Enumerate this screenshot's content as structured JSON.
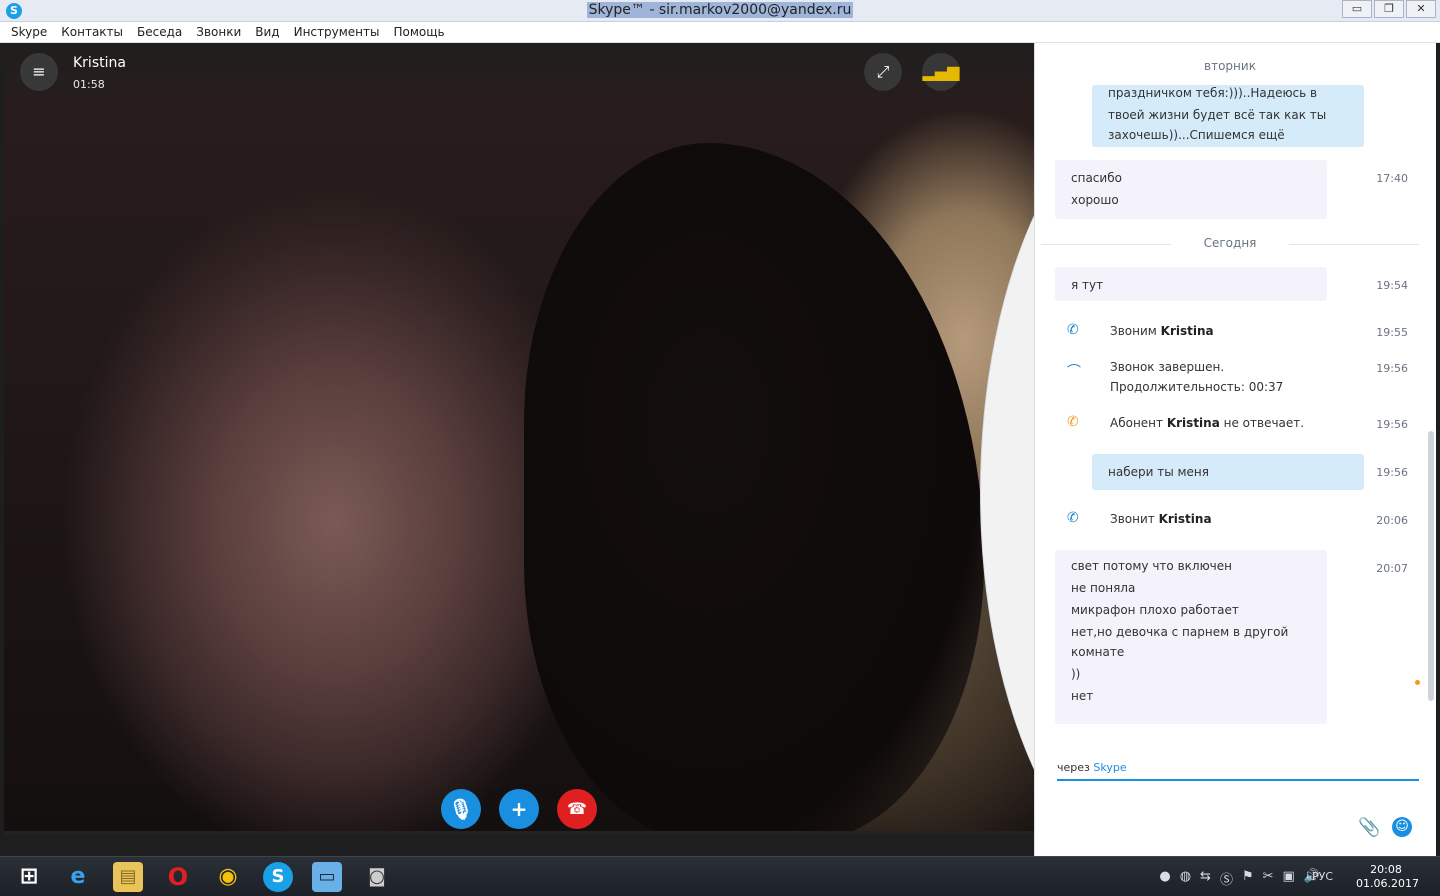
{
  "window": {
    "title": "Skype™ - sir.markov2000@yandex.ru",
    "controls": {
      "minimize": "▭",
      "restore": "❐",
      "close": "✕"
    }
  },
  "menu": [
    "Skype",
    "Контакты",
    "Беседа",
    "Звонки",
    "Вид",
    "Инструменты",
    "Помощь"
  ],
  "call": {
    "contact": "Kristina",
    "duration": "01:58",
    "icons": {
      "menu": "≡",
      "fullscreen": "⤢",
      "signal": "▂▄▆",
      "chat": "💬",
      "mic": "🎙",
      "add": "+",
      "hangup": "☎"
    }
  },
  "chat": {
    "day_tuesday": "вторник",
    "prev_out_message": [
      "праздничком тебя:)))..Надеюсь в",
      "твоей жизни будет всё так как ты",
      "захочешь))...Спишемся ещё"
    ],
    "msg1": {
      "lines": [
        "спасибо",
        "хорошо"
      ],
      "time": "17:40"
    },
    "day_today": "Сегодня",
    "msg2": {
      "lines": [
        "я тут"
      ],
      "time": "19:54"
    },
    "ev_calling": {
      "prefix": "Звоним",
      "name": "Kristina",
      "time": "19:55"
    },
    "ev_ended": {
      "line1": "Звонок завершен.",
      "line2": "Продолжительность: 00:37",
      "time": "19:56"
    },
    "ev_noanswer": {
      "prefix": "Абонент",
      "name": "Kristina",
      "suffix": "не отвечает.",
      "time": "19:56"
    },
    "msg_out": {
      "text": "набери ты меня",
      "time": "19:56"
    },
    "ev_incoming": {
      "prefix": "Звонит",
      "name": "Kristina",
      "time": "20:06"
    },
    "msg3": {
      "lines": [
        "свет потому что включен",
        "не поняла",
        "микрафон плохо работает",
        "нет,но девочка с парнем в другой",
        "комнате",
        "))",
        "нет"
      ],
      "time": "20:07"
    },
    "input": {
      "via": "через",
      "via_link": "Skype"
    }
  },
  "taskbar": {
    "lang": "РУС",
    "time": "20:08",
    "date": "01.06.2017"
  }
}
